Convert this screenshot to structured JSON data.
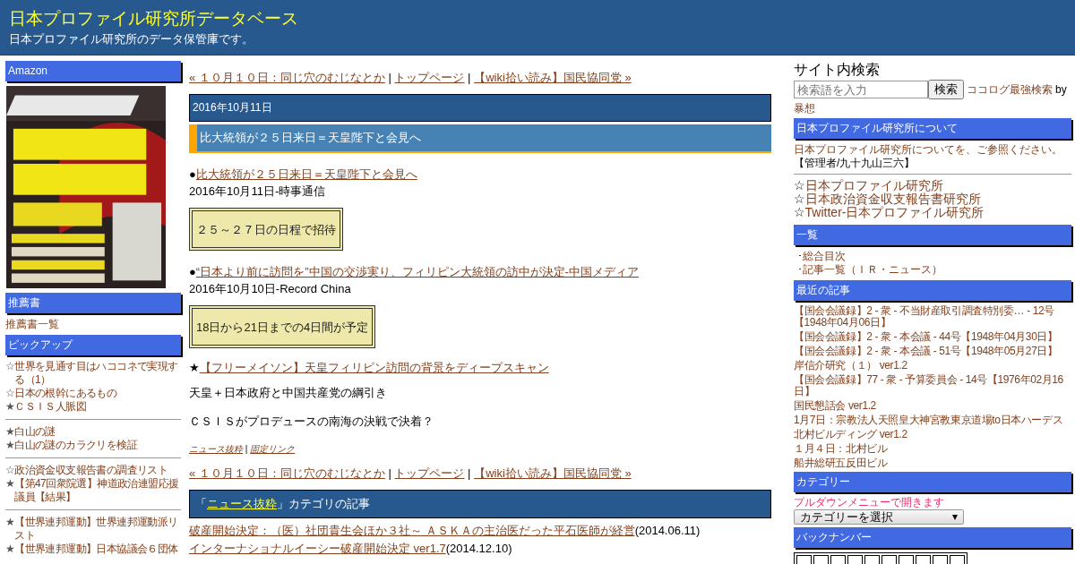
{
  "header": {
    "title": "日本プロファイル研究所データベース",
    "subtitle": "日本プロファイル研究所のデータ保管庫です。"
  },
  "left_sidebar": {
    "amazon": {
      "heading": "Amazon"
    },
    "recommended": {
      "heading": "推薦書",
      "items": [
        "推薦書一覧"
      ]
    },
    "pickup": {
      "heading": "ピックアップ",
      "groups": [
        [
          {
            "mark": "☆",
            "text": "世界を見通す目はハココネで実現する（1）"
          },
          {
            "mark": "☆",
            "text": "日本の根幹にあるもの"
          },
          {
            "mark": "★",
            "text": "ＣＳＩＳ人脈図"
          }
        ],
        [
          {
            "mark": "★",
            "text": "白山の謎"
          },
          {
            "mark": "★",
            "text": "白山の謎のカラクリを検証"
          }
        ],
        [
          {
            "mark": "☆",
            "text": "政治資金収支報告書の調査リスト"
          },
          {
            "mark": "★",
            "text": "【第47回衆院選】神道政治連盟応援議員【結果】"
          }
        ],
        [
          {
            "mark": "★",
            "text": "【世界連邦運動】世界連邦運動派リスト"
          },
          {
            "mark": "★",
            "text": "【世界連邦運動】日本協議会６団体"
          }
        ]
      ]
    }
  },
  "entry_nav": {
    "prev": "« １０月１０日：同じ穴のむじなとか",
    "separator_1": "|",
    "top": "トップページ",
    "separator_2": "|",
    "next": "【wiki拾い読み】国民協同党 »"
  },
  "date": "2016年10月11日",
  "entry": {
    "title": "比大統領が２５日来日＝天皇陛下と会見へ",
    "blocks": [
      {
        "kind": "news",
        "bullet": "●",
        "link": "比大統領が２５日来日＝天皇陛下と会見へ",
        "source": "2016年10月11日-時事通信"
      },
      {
        "kind": "callout",
        "text": "２５～２７日の日程で招待"
      },
      {
        "kind": "news",
        "bullet": "●",
        "link": "“日本より前に訪問を”中国の交渉実り、フィリピン大統領の訪中が決定-中国メディア",
        "source": "2016年10月10日-Record China"
      },
      {
        "kind": "callout",
        "text": "18日から21日までの4日間が予定"
      },
      {
        "kind": "star_link",
        "bullet": "★",
        "link": "【フリーメイソン】天皇フィリピン訪問の背景をディープスキャン"
      },
      {
        "kind": "para",
        "text": "天皇＋日本政府と中国共産党の綱引き"
      },
      {
        "kind": "para",
        "text": "ＣＳＩＳがプロデュースの南海の決戦で決着？"
      }
    ],
    "footer": {
      "category": "ニュース抜粋",
      "separator": "|",
      "permalink": "固定リンク"
    }
  },
  "entry_nav_bottom": {
    "prev": "« １０月１０日：同じ穴のむじなとか",
    "separator_1": "|",
    "top": "トップページ",
    "separator_2": "|",
    "next": "【wiki拾い読み】国民協同党 »"
  },
  "category_articles": {
    "prefix": "「",
    "category": "ニュース抜粋",
    "suffix": "」カテゴリの記事",
    "items": [
      {
        "title": "破産開始決定：（医）社団貴生会ほか３社～ ＡＳＫＡの主治医だった平石医師が経営",
        "date": "(2014.06.11)"
      },
      {
        "title": "インターナショナルイーシー破産開始決定 ver1.7",
        "date": "(2014.12.10)"
      }
    ]
  },
  "right_sidebar": {
    "search": {
      "heading": "サイト内検索",
      "placeholder": "検索語を入力",
      "button": "検索",
      "credit": "ココログ最強検索",
      "by": "by",
      "author": "暴想"
    },
    "about": {
      "heading": "日本プロファイル研究所について",
      "link": "日本プロファイル研究所について",
      "rest": "を、ご参照ください。",
      "admin": "【管理者/九十九山三六】"
    },
    "sites": [
      {
        "mark": "☆",
        "text": "日本プロファイル研究所"
      },
      {
        "mark": "☆",
        "text": "日本政治資金収支報告書研究所"
      },
      {
        "mark": "☆",
        "text": "Twitter-日本プロファイル研究所"
      }
    ],
    "index": {
      "heading": "一覧",
      "items": [
        {
          "mark": "･",
          "text": "総合目次"
        },
        {
          "mark": "･",
          "text": "記事一覧（ＩＲ・ニュース）"
        }
      ]
    },
    "recent": {
      "heading": "最近の記事",
      "items": [
        "【国会会議録】2 - 衆 - 不当財産取引調査特別委… - 12号【1948年04月06日】",
        "【国会会議録】2 - 衆 - 本会議 - 44号【1948年04月30日】",
        "【国会会議録】2 - 衆 - 本会議 - 51号【1948年05月27日】",
        "岸信介研究（１） ver1.2",
        "【国会会議録】77 - 衆 - 予算委員会 - 14号【1976年02月16日】",
        "国民懇話会 ver1.2",
        "1月7日：宗教法人天照皇大神宮教東京道場to日本ハーデス",
        "北村ビルディング ver1.2",
        "１月４日：北村ビル",
        "船井総研五反田ビル"
      ]
    },
    "categories": {
      "heading": "カテゴリー",
      "hint": "プルダウンメニューで開きます",
      "select": "カテゴリーを選択"
    },
    "backnumber": {
      "heading": "バックナンバー"
    }
  }
}
